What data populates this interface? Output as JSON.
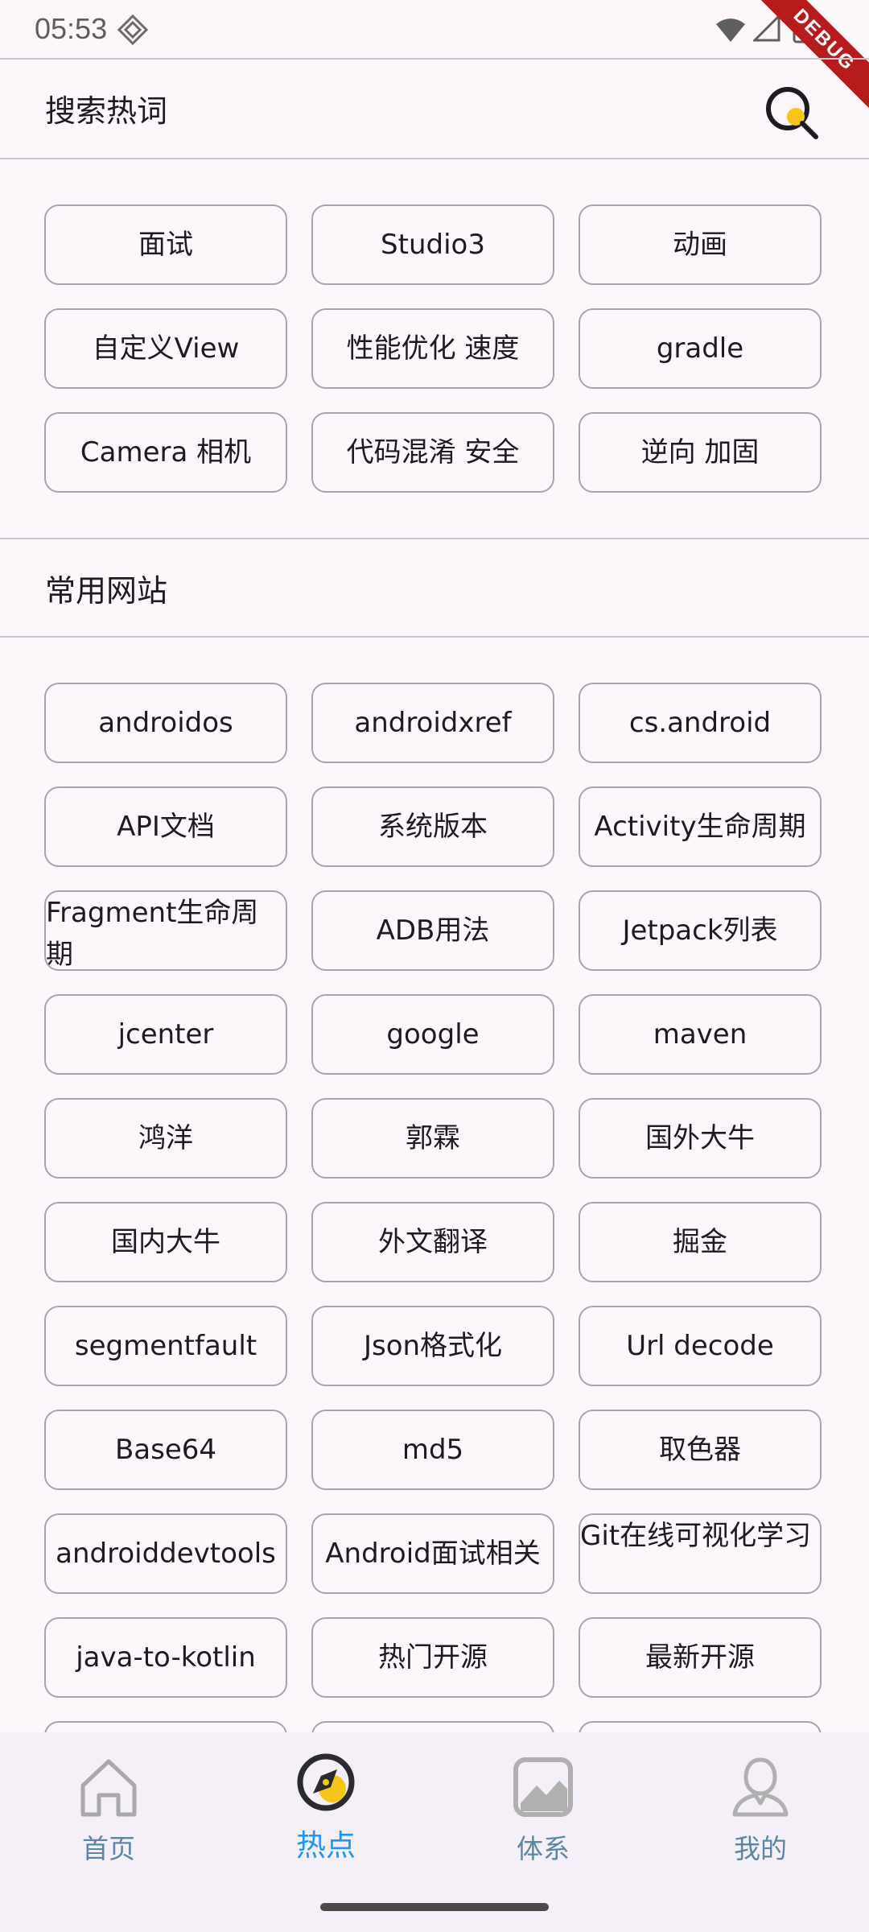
{
  "status_bar": {
    "time": "05:53",
    "debug_label": "DEBUG"
  },
  "hot_search": {
    "title": "搜索热词",
    "search_icon": "search-icon",
    "items": [
      "面试",
      "Studio3",
      "动画",
      "自定义View",
      "性能优化 速度",
      "gradle",
      "Camera 相机",
      "代码混淆 安全",
      "逆向 加固"
    ]
  },
  "websites": {
    "title": "常用网站",
    "items": [
      "androidos",
      "androidxref",
      "cs.android",
      "API文档",
      "系统版本",
      "Activity生命周期",
      "Fragment生命周期",
      "ADB用法",
      "Jetpack列表",
      "jcenter",
      "google",
      "maven",
      "鸿洋",
      "郭霖",
      "国外大牛",
      "国内大牛",
      "外文翻译",
      "掘金",
      "segmentfault",
      "Json格式化",
      "Url decode",
      "Base64",
      "md5",
      "取色器",
      "androiddevtools",
      "Android面试相关",
      "Git在线可视化学习",
      "java-to-kotlin",
      "热门开源",
      "最新开源",
      "",
      "",
      ""
    ]
  },
  "bottom_nav": {
    "items": [
      {
        "label": "首页",
        "icon": "home-icon",
        "active": false
      },
      {
        "label": "热点",
        "icon": "compass-icon",
        "active": true
      },
      {
        "label": "体系",
        "icon": "image-icon",
        "active": false
      },
      {
        "label": "我的",
        "icon": "person-icon",
        "active": false
      }
    ]
  },
  "colors": {
    "background": "#fdf7fc",
    "accent": "#2196f3",
    "search_dot": "#f5c518",
    "chip_border": "#a8a4ab",
    "nav_label": "#5d86a3"
  }
}
